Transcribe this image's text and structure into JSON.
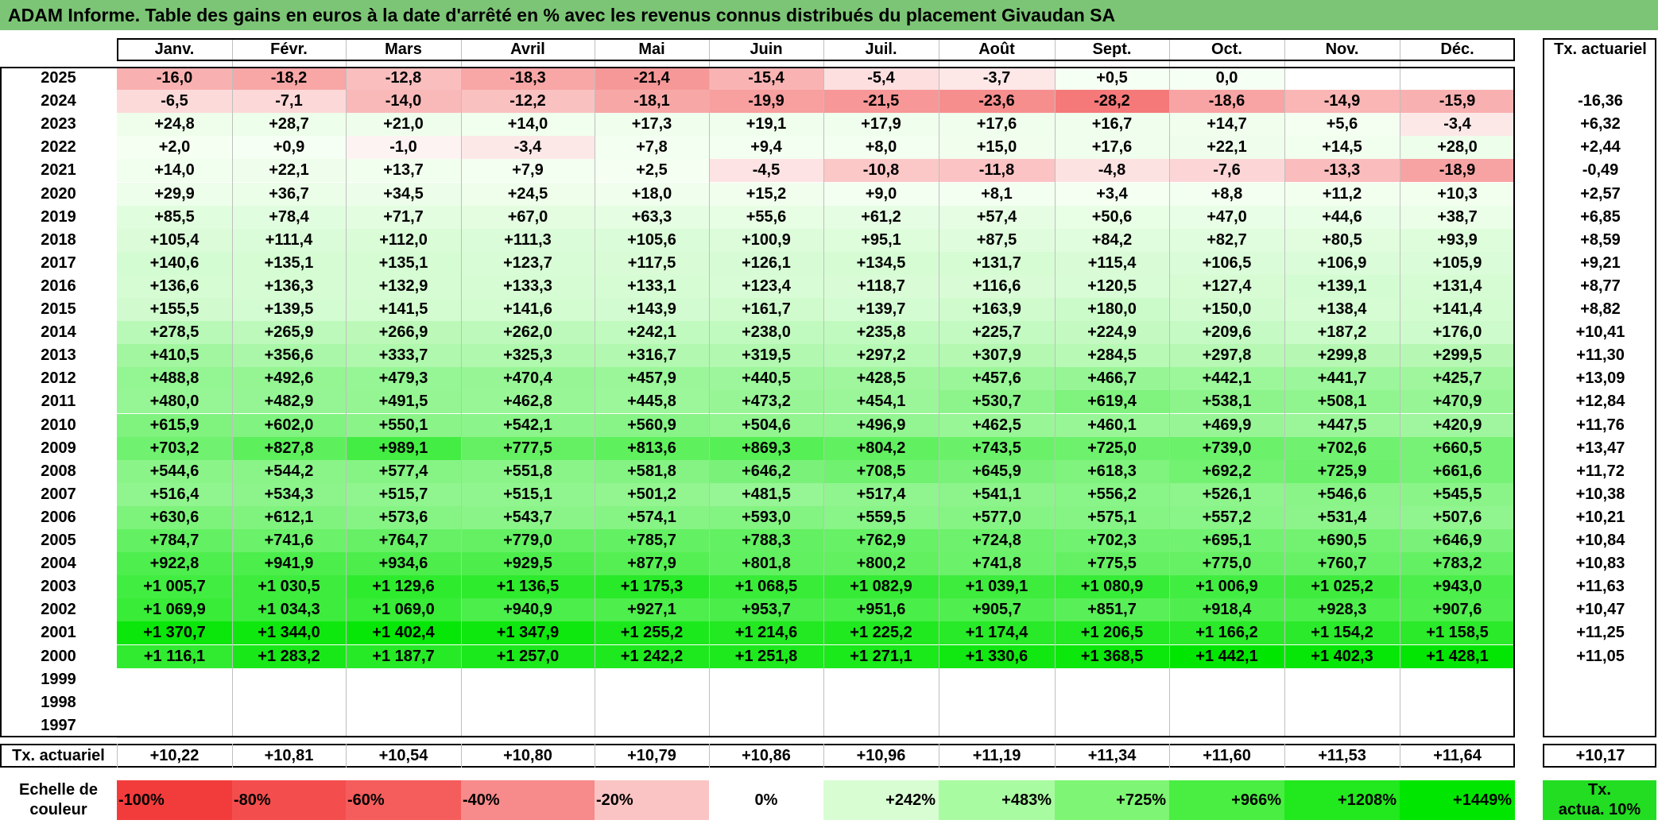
{
  "title": "ADAM Informe. Table des gains en euros à la date d'arrêté en % avec les revenus connus distribués du placement Givaudan SA",
  "months": [
    "Janv.",
    "Févr.",
    "Mars",
    "Avril",
    "Mai",
    "Juin",
    "Juil.",
    "Août",
    "Sept.",
    "Oct.",
    "Nov.",
    "Déc."
  ],
  "rate_header": "Tx. actuariel",
  "rows": [
    {
      "year": "2025",
      "values": [
        "-16,0",
        "-18,2",
        "-12,8",
        "-18,3",
        "-21,4",
        "-15,4",
        "-5,4",
        "-3,7",
        "+0,5",
        "0,0",
        "",
        ""
      ],
      "rate": ""
    },
    {
      "year": "2024",
      "values": [
        "-6,5",
        "-7,1",
        "-14,0",
        "-12,2",
        "-18,1",
        "-19,9",
        "-21,5",
        "-23,6",
        "-28,2",
        "-18,6",
        "-14,9",
        "-15,9"
      ],
      "rate": "-16,36"
    },
    {
      "year": "2023",
      "values": [
        "+24,8",
        "+28,7",
        "+21,0",
        "+14,0",
        "+17,3",
        "+19,1",
        "+17,9",
        "+17,6",
        "+16,7",
        "+14,7",
        "+5,6",
        "-3,4"
      ],
      "rate": "+6,32"
    },
    {
      "year": "2022",
      "values": [
        "+2,0",
        "+0,9",
        "-1,0",
        "-3,4",
        "+7,8",
        "+9,4",
        "+8,0",
        "+15,0",
        "+17,6",
        "+22,1",
        "+14,5",
        "+28,0"
      ],
      "rate": "+2,44"
    },
    {
      "year": "2021",
      "values": [
        "+14,0",
        "+22,1",
        "+13,7",
        "+7,9",
        "+2,5",
        "-4,5",
        "-10,8",
        "-11,8",
        "-4,8",
        "-7,6",
        "-13,3",
        "-18,9"
      ],
      "rate": "-0,49"
    },
    {
      "year": "2020",
      "values": [
        "+29,9",
        "+36,7",
        "+34,5",
        "+24,5",
        "+18,0",
        "+15,2",
        "+9,0",
        "+8,1",
        "+3,4",
        "+8,8",
        "+11,2",
        "+10,3"
      ],
      "rate": "+2,57"
    },
    {
      "year": "2019",
      "values": [
        "+85,5",
        "+78,4",
        "+71,7",
        "+67,0",
        "+63,3",
        "+55,6",
        "+61,2",
        "+57,4",
        "+50,6",
        "+47,0",
        "+44,6",
        "+38,7"
      ],
      "rate": "+6,85"
    },
    {
      "year": "2018",
      "values": [
        "+105,4",
        "+111,4",
        "+112,0",
        "+111,3",
        "+105,6",
        "+100,9",
        "+95,1",
        "+87,5",
        "+84,2",
        "+82,7",
        "+80,5",
        "+93,9"
      ],
      "rate": "+8,59"
    },
    {
      "year": "2017",
      "values": [
        "+140,6",
        "+135,1",
        "+135,1",
        "+123,7",
        "+117,5",
        "+126,1",
        "+134,5",
        "+131,7",
        "+115,4",
        "+106,5",
        "+106,9",
        "+105,9"
      ],
      "rate": "+9,21"
    },
    {
      "year": "2016",
      "values": [
        "+136,6",
        "+136,3",
        "+132,9",
        "+133,3",
        "+133,1",
        "+123,4",
        "+118,7",
        "+116,6",
        "+120,5",
        "+127,4",
        "+139,1",
        "+131,4"
      ],
      "rate": "+8,77"
    },
    {
      "year": "2015",
      "values": [
        "+155,5",
        "+139,5",
        "+141,5",
        "+141,6",
        "+143,9",
        "+161,7",
        "+139,7",
        "+163,9",
        "+180,0",
        "+150,0",
        "+138,4",
        "+141,4"
      ],
      "rate": "+8,82"
    },
    {
      "year": "2014",
      "values": [
        "+278,5",
        "+265,9",
        "+266,9",
        "+262,0",
        "+242,1",
        "+238,0",
        "+235,8",
        "+225,7",
        "+224,9",
        "+209,6",
        "+187,2",
        "+176,0"
      ],
      "rate": "+10,41"
    },
    {
      "year": "2013",
      "values": [
        "+410,5",
        "+356,6",
        "+333,7",
        "+325,3",
        "+316,7",
        "+319,5",
        "+297,2",
        "+307,9",
        "+284,5",
        "+297,8",
        "+299,8",
        "+299,5"
      ],
      "rate": "+11,30"
    },
    {
      "year": "2012",
      "values": [
        "+488,8",
        "+492,6",
        "+479,3",
        "+470,4",
        "+457,9",
        "+440,5",
        "+428,5",
        "+457,6",
        "+466,7",
        "+442,1",
        "+441,7",
        "+425,7"
      ],
      "rate": "+13,09"
    },
    {
      "year": "2011",
      "values": [
        "+480,0",
        "+482,9",
        "+491,5",
        "+462,8",
        "+445,8",
        "+473,2",
        "+454,1",
        "+530,7",
        "+619,4",
        "+538,1",
        "+508,1",
        "+470,9"
      ],
      "rate": "+12,84"
    },
    {
      "year": "2010",
      "values": [
        "+615,9",
        "+602,0",
        "+550,1",
        "+542,1",
        "+560,9",
        "+504,6",
        "+496,9",
        "+462,5",
        "+460,1",
        "+469,9",
        "+447,5",
        "+420,9"
      ],
      "rate": "+11,76"
    },
    {
      "year": "2009",
      "values": [
        "+703,2",
        "+827,8",
        "+989,1",
        "+777,5",
        "+813,6",
        "+869,3",
        "+804,2",
        "+743,5",
        "+725,0",
        "+739,0",
        "+702,6",
        "+660,5"
      ],
      "rate": "+13,47"
    },
    {
      "year": "2008",
      "values": [
        "+544,6",
        "+544,2",
        "+577,4",
        "+551,8",
        "+581,8",
        "+646,2",
        "+708,5",
        "+645,9",
        "+618,3",
        "+692,2",
        "+725,9",
        "+661,6"
      ],
      "rate": "+11,72"
    },
    {
      "year": "2007",
      "values": [
        "+516,4",
        "+534,3",
        "+515,7",
        "+515,1",
        "+501,2",
        "+481,5",
        "+517,4",
        "+541,1",
        "+556,2",
        "+526,1",
        "+546,6",
        "+545,5"
      ],
      "rate": "+10,38"
    },
    {
      "year": "2006",
      "values": [
        "+630,6",
        "+612,1",
        "+573,6",
        "+543,7",
        "+574,1",
        "+593,0",
        "+559,5",
        "+577,0",
        "+575,1",
        "+557,2",
        "+531,4",
        "+507,6"
      ],
      "rate": "+10,21"
    },
    {
      "year": "2005",
      "values": [
        "+784,7",
        "+741,6",
        "+764,7",
        "+779,0",
        "+785,7",
        "+788,3",
        "+762,9",
        "+724,8",
        "+702,3",
        "+695,1",
        "+690,5",
        "+646,9"
      ],
      "rate": "+10,84"
    },
    {
      "year": "2004",
      "values": [
        "+922,8",
        "+941,9",
        "+934,6",
        "+929,5",
        "+877,9",
        "+801,8",
        "+800,2",
        "+741,8",
        "+775,5",
        "+775,0",
        "+760,7",
        "+783,2"
      ],
      "rate": "+10,83"
    },
    {
      "year": "2003",
      "values": [
        "+1 005,7",
        "+1 030,5",
        "+1 129,6",
        "+1 136,5",
        "+1 175,3",
        "+1 068,5",
        "+1 082,9",
        "+1 039,1",
        "+1 080,9",
        "+1 006,9",
        "+1 025,2",
        "+943,0"
      ],
      "rate": "+11,63"
    },
    {
      "year": "2002",
      "values": [
        "+1 069,9",
        "+1 034,3",
        "+1 069,0",
        "+940,9",
        "+927,1",
        "+953,7",
        "+951,6",
        "+905,7",
        "+851,7",
        "+918,4",
        "+928,3",
        "+907,6"
      ],
      "rate": "+10,47"
    },
    {
      "year": "2001",
      "values": [
        "+1 370,7",
        "+1 344,0",
        "+1 402,4",
        "+1 347,9",
        "+1 255,2",
        "+1 214,6",
        "+1 225,2",
        "+1 174,4",
        "+1 206,5",
        "+1 166,2",
        "+1 154,2",
        "+1 158,5"
      ],
      "rate": "+11,25"
    },
    {
      "year": "2000",
      "values": [
        "+1 116,1",
        "+1 283,2",
        "+1 187,7",
        "+1 257,0",
        "+1 242,2",
        "+1 251,8",
        "+1 271,1",
        "+1 330,6",
        "+1 368,5",
        "+1 442,1",
        "+1 402,3",
        "+1 428,1"
      ],
      "rate": "+11,05"
    },
    {
      "year": "1999",
      "values": [
        "",
        "",
        "",
        "",
        "",
        "",
        "",
        "",
        "",
        "",
        "",
        ""
      ],
      "rate": ""
    },
    {
      "year": "1998",
      "values": [
        "",
        "",
        "",
        "",
        "",
        "",
        "",
        "",
        "",
        "",
        "",
        ""
      ],
      "rate": ""
    },
    {
      "year": "1997",
      "values": [
        "",
        "",
        "",
        "",
        "",
        "",
        "",
        "",
        "",
        "",
        "",
        ""
      ],
      "rate": ""
    }
  ],
  "footer": {
    "label": "Tx. actuariel",
    "values": [
      "+10,22",
      "+10,81",
      "+10,54",
      "+10,80",
      "+10,79",
      "+10,86",
      "+10,96",
      "+11,19",
      "+11,34",
      "+11,60",
      "+11,53",
      "+11,64"
    ],
    "rate": "+10,17"
  },
  "scale": {
    "label_line1": "Echelle de",
    "label_line2": "couleur",
    "steps": [
      "-100%",
      "-80%",
      "-60%",
      "-40%",
      "-20%",
      "0%",
      "+242%",
      "+483%",
      "+725%",
      "+966%",
      "+1208%",
      "+1449%"
    ],
    "rate_line1": "Tx.",
    "rate_line2": "actua. 10%"
  },
  "colors": {
    "title_bar": "#7cc576",
    "negative_max": "#f23c3c",
    "positive_max": "#00e600",
    "neutral": "#ffffff",
    "rate_legend": "#22dd22"
  }
}
